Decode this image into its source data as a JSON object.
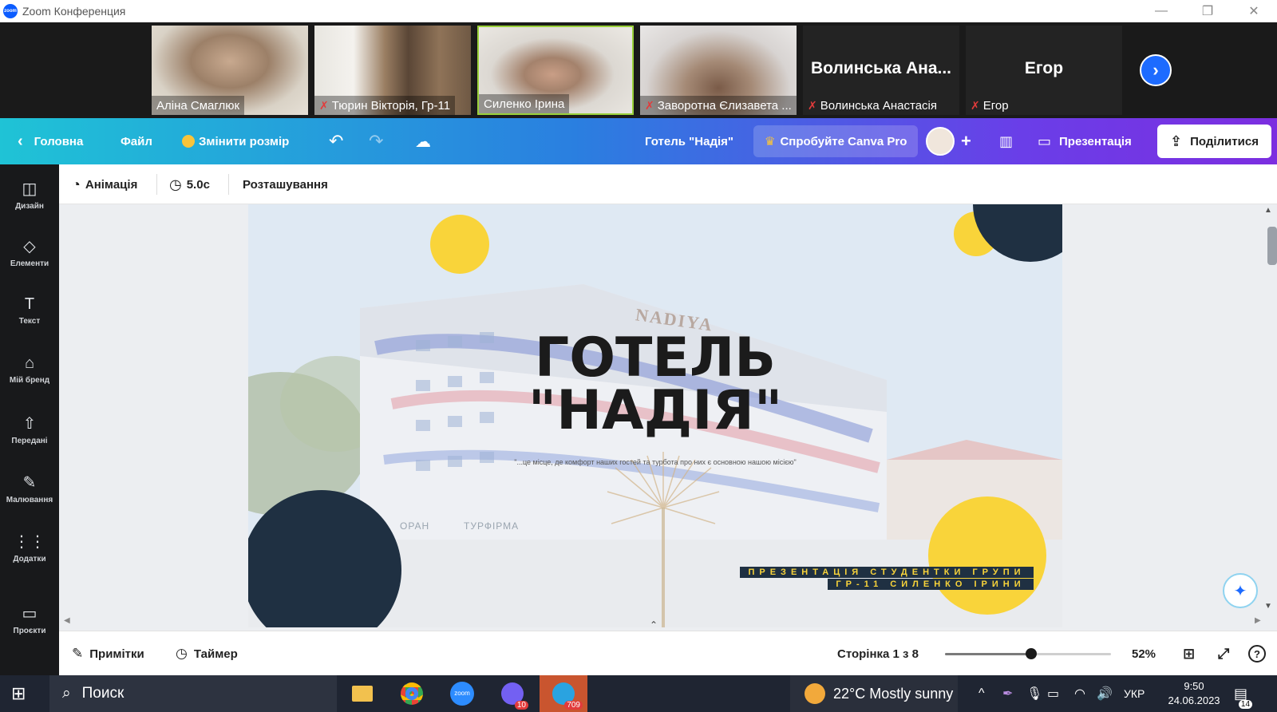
{
  "zoom": {
    "window_title": "Zoom Конференция",
    "participants": [
      {
        "name": "Аліна Смаглюк",
        "muted": false,
        "active": false
      },
      {
        "name": "Тюрин Вікторія, Гр-11",
        "muted": true,
        "active": false
      },
      {
        "name": "Силенко Ірина",
        "muted": false,
        "active": true
      },
      {
        "name": "Заворотна Єлизавета ...",
        "muted": true,
        "active": false
      },
      {
        "name": "Волинська Анастасія",
        "display": "Волинська  Ана...",
        "muted": true,
        "active": false
      },
      {
        "name": "Егор",
        "display": "Егор",
        "muted": true,
        "active": false
      }
    ]
  },
  "canva": {
    "top": {
      "home": "Головна",
      "file": "Файл",
      "resize": "Змінити розмір",
      "doc_title": "Готель \"Надія\"",
      "try_pro": "Спробуйте Canva Pro",
      "present": "Презентація",
      "share": "Поділитися"
    },
    "sidebar": [
      {
        "label": "Дизайн",
        "icon": "layout-icon"
      },
      {
        "label": "Елементи",
        "icon": "shapes-icon"
      },
      {
        "label": "Текст",
        "icon": "text-icon"
      },
      {
        "label": "Мій бренд",
        "icon": "brand-icon"
      },
      {
        "label": "Передані",
        "icon": "upload-icon"
      },
      {
        "label": "Малювання",
        "icon": "draw-icon"
      },
      {
        "label": "Додатки",
        "icon": "apps-icon"
      },
      {
        "label": "Проєкти",
        "icon": "folder-icon"
      }
    ],
    "toolbar": {
      "animation": "Анімація",
      "duration": "5.0с",
      "position": "Розташування"
    },
    "slide": {
      "brand_sign": "NADIYA",
      "title_line1": "ГОТЕЛЬ",
      "title_line2": "\"НАДІЯ\"",
      "tagline": "\"...це місце, де комфорт наших гостей та турбота про них є основною нашою місією\"",
      "caption_line1": "ПРЕЗЕНТАЦІЯ СТУДЕНТКИ ГРУПИ",
      "caption_line2": "ГР-11 СИЛЕНКО ІРИНИ",
      "sign_left": "ОРАН",
      "sign_right": "ТУРФІРМА"
    },
    "bottom": {
      "notes": "Примітки",
      "timer": "Таймер",
      "page": "Сторінка 1 з 8",
      "zoom": "52%",
      "zoom_fraction": 0.52
    },
    "colors": {
      "accent_yellow": "#f9d43a",
      "navy": "#1f3042"
    }
  },
  "taskbar": {
    "search": "Поиск",
    "viber_badge": "10",
    "telegram_badge": "709",
    "weather": "22°C  Mostly sunny",
    "lang": "УКР",
    "time": "9:50",
    "date": "24.06.2023",
    "notifications": "14"
  }
}
